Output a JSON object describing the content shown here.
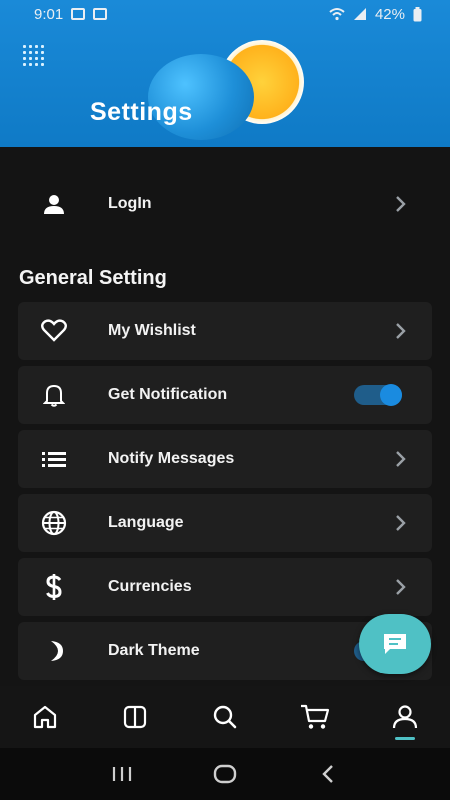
{
  "status_bar": {
    "time": "9:01",
    "battery": "42%"
  },
  "header": {
    "title": "Settings"
  },
  "login": {
    "label": "LogIn",
    "icon": "person-icon"
  },
  "general_section": {
    "title": "General Setting"
  },
  "settings": [
    {
      "label": "My Wishlist",
      "icon": "heart-icon",
      "control": "chevron"
    },
    {
      "label": "Get Notification",
      "icon": "bell-icon",
      "control": "toggle",
      "toggle_on": true
    },
    {
      "label": "Notify Messages",
      "icon": "list-icon",
      "control": "chevron"
    },
    {
      "label": "Language",
      "icon": "globe-icon",
      "control": "chevron"
    },
    {
      "label": "Currencies",
      "icon": "dollar-icon",
      "control": "chevron"
    },
    {
      "label": "Dark Theme",
      "icon": "moon-icon",
      "control": "toggle",
      "toggle_on": true
    }
  ],
  "bottom_nav": {
    "items": [
      {
        "name": "home",
        "icon": "home-icon"
      },
      {
        "name": "categories",
        "icon": "columns-icon"
      },
      {
        "name": "search",
        "icon": "search-icon"
      },
      {
        "name": "cart",
        "icon": "cart-icon"
      },
      {
        "name": "profile",
        "icon": "person-icon",
        "active": true
      }
    ]
  },
  "colors": {
    "accent": "#4fc1c5",
    "header_blue": "#1a8ad8",
    "toggle_blue": "#1a8be0",
    "background": "#141414",
    "row_background": "#1f1f1f"
  }
}
